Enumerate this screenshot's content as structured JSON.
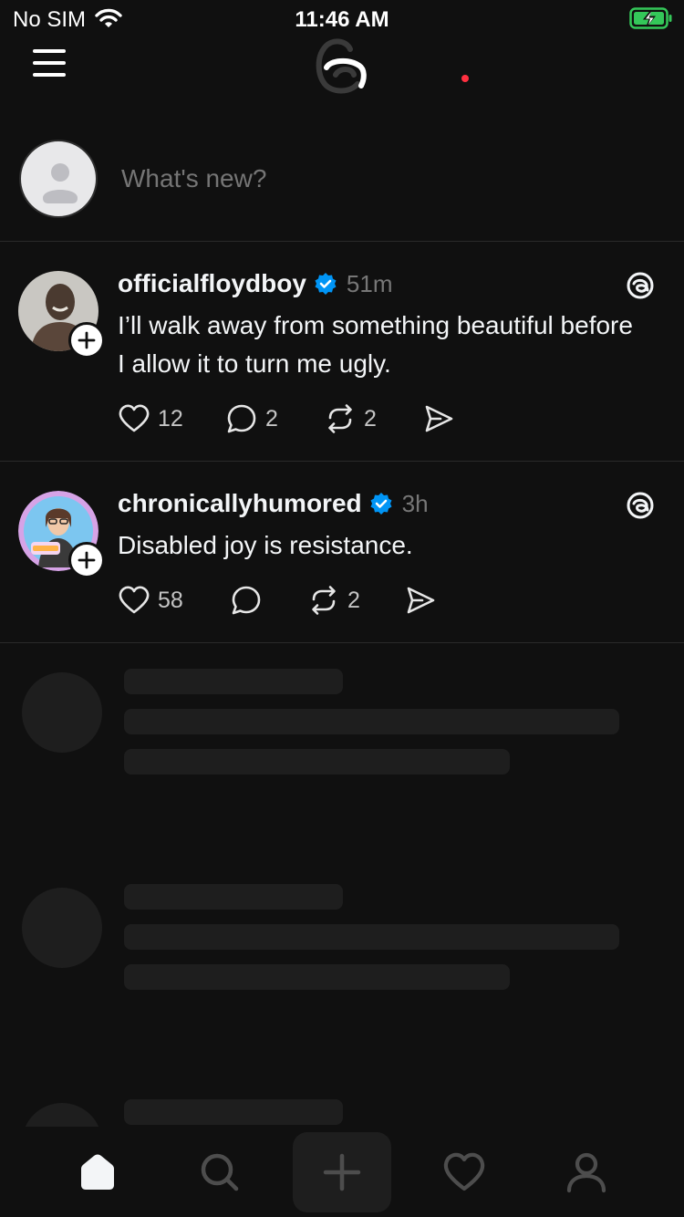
{
  "status_bar": {
    "carrier": "No SIM",
    "time": "11:46 AM"
  },
  "composer": {
    "placeholder": "What's new?"
  },
  "posts": [
    {
      "username": "officialfloydboy",
      "time": "51m",
      "text": "I’ll walk away from something beautiful before I allow it to turn me ugly.",
      "likes": "12",
      "replies": "2",
      "reposts": "2"
    },
    {
      "username": "chronicallyhumored",
      "time": "3h",
      "text": "Disabled joy is resistance.",
      "likes": "58",
      "replies": "",
      "reposts": "2"
    }
  ],
  "tab_bar": {
    "items": [
      "home-icon",
      "search-icon",
      "compose-icon",
      "activity-icon",
      "profile-icon"
    ],
    "active": "home-icon"
  },
  "colors": {
    "background": "#101010",
    "verified": "#0095f6",
    "notification_dot": "#ff3040"
  }
}
